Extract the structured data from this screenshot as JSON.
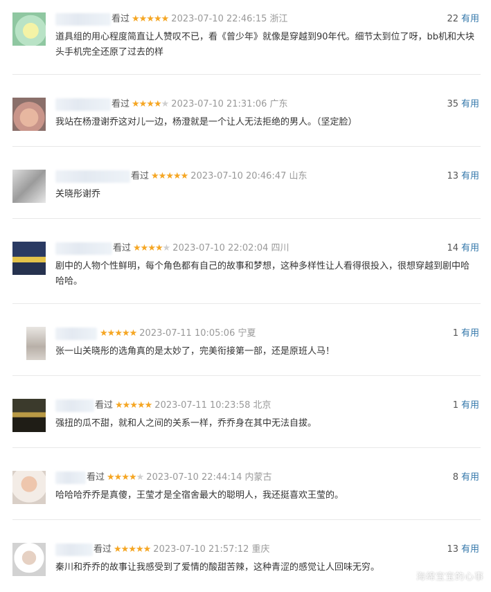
{
  "reviews": [
    {
      "user_suffix": "看过",
      "rating": 5,
      "time": "2023-07-10 22:46:15",
      "location": "浙江",
      "useful_count": "22",
      "useful_label": "有用",
      "content": "道具组的用心程度简直让人赞叹不已，看《曾少年》就像是穿越到90年代。细节太到位了呀，bb机和大块头手机完全还原了过去的样"
    },
    {
      "user_suffix": "看过",
      "rating": 4,
      "time": "2023-07-10 21:31:06",
      "location": "广东",
      "useful_count": "35",
      "useful_label": "有用",
      "content": "我站在杨澄谢乔这对儿一边，杨澄就是一个让人无法拒绝的男人。（坚定脸）"
    },
    {
      "user_suffix": "看过",
      "rating": 5,
      "time": "2023-07-10 20:46:47",
      "location": "山东",
      "useful_count": "13",
      "useful_label": "有用",
      "content": "关晓彤谢乔"
    },
    {
      "user_suffix": "看过",
      "rating": 4,
      "time": "2023-07-10 22:02:04",
      "location": "四川",
      "useful_count": "14",
      "useful_label": "有用",
      "content": "剧中的人物个性鲜明，每个角色都有自己的故事和梦想，这种多样性让人看得很投入，很想穿越到剧中哈哈哈。"
    },
    {
      "user_suffix": "",
      "rating": 5,
      "time": "2023-07-11 10:05:06",
      "location": "宁夏",
      "useful_count": "1",
      "useful_label": "有用",
      "content": "张一山关晓彤的选角真的是太妙了，完美衔接第一部，还是原班人马！"
    },
    {
      "user_suffix": "看过",
      "rating": 5,
      "time": "2023-07-11 10:23:58",
      "location": "北京",
      "useful_count": "1",
      "useful_label": "有用",
      "content": "强扭的瓜不甜，就和人之间的关系一样，乔乔身在其中无法自拔。"
    },
    {
      "user_suffix": "看过",
      "rating": 4,
      "time": "2023-07-10 22:44:14",
      "location": "内蒙古",
      "useful_count": "8",
      "useful_label": "有用",
      "content": "哈哈哈乔乔是真傻，王莹才是全宿舍最大的聪明人，我还挺喜欢王莹的。"
    },
    {
      "user_suffix": "看过",
      "rating": 5,
      "time": "2023-07-10 21:57:12",
      "location": "重庆",
      "useful_count": "13",
      "useful_label": "有用",
      "content": "秦川和乔乔的故事让我感受到了爱情的酸甜苦辣，这种青涩的感觉让人回味无穷。"
    }
  ],
  "watermark": "海绵宝宝的心事",
  "colors": {
    "star": "#f5a623",
    "link": "#3377aa",
    "divider": "#e8e8e8"
  }
}
